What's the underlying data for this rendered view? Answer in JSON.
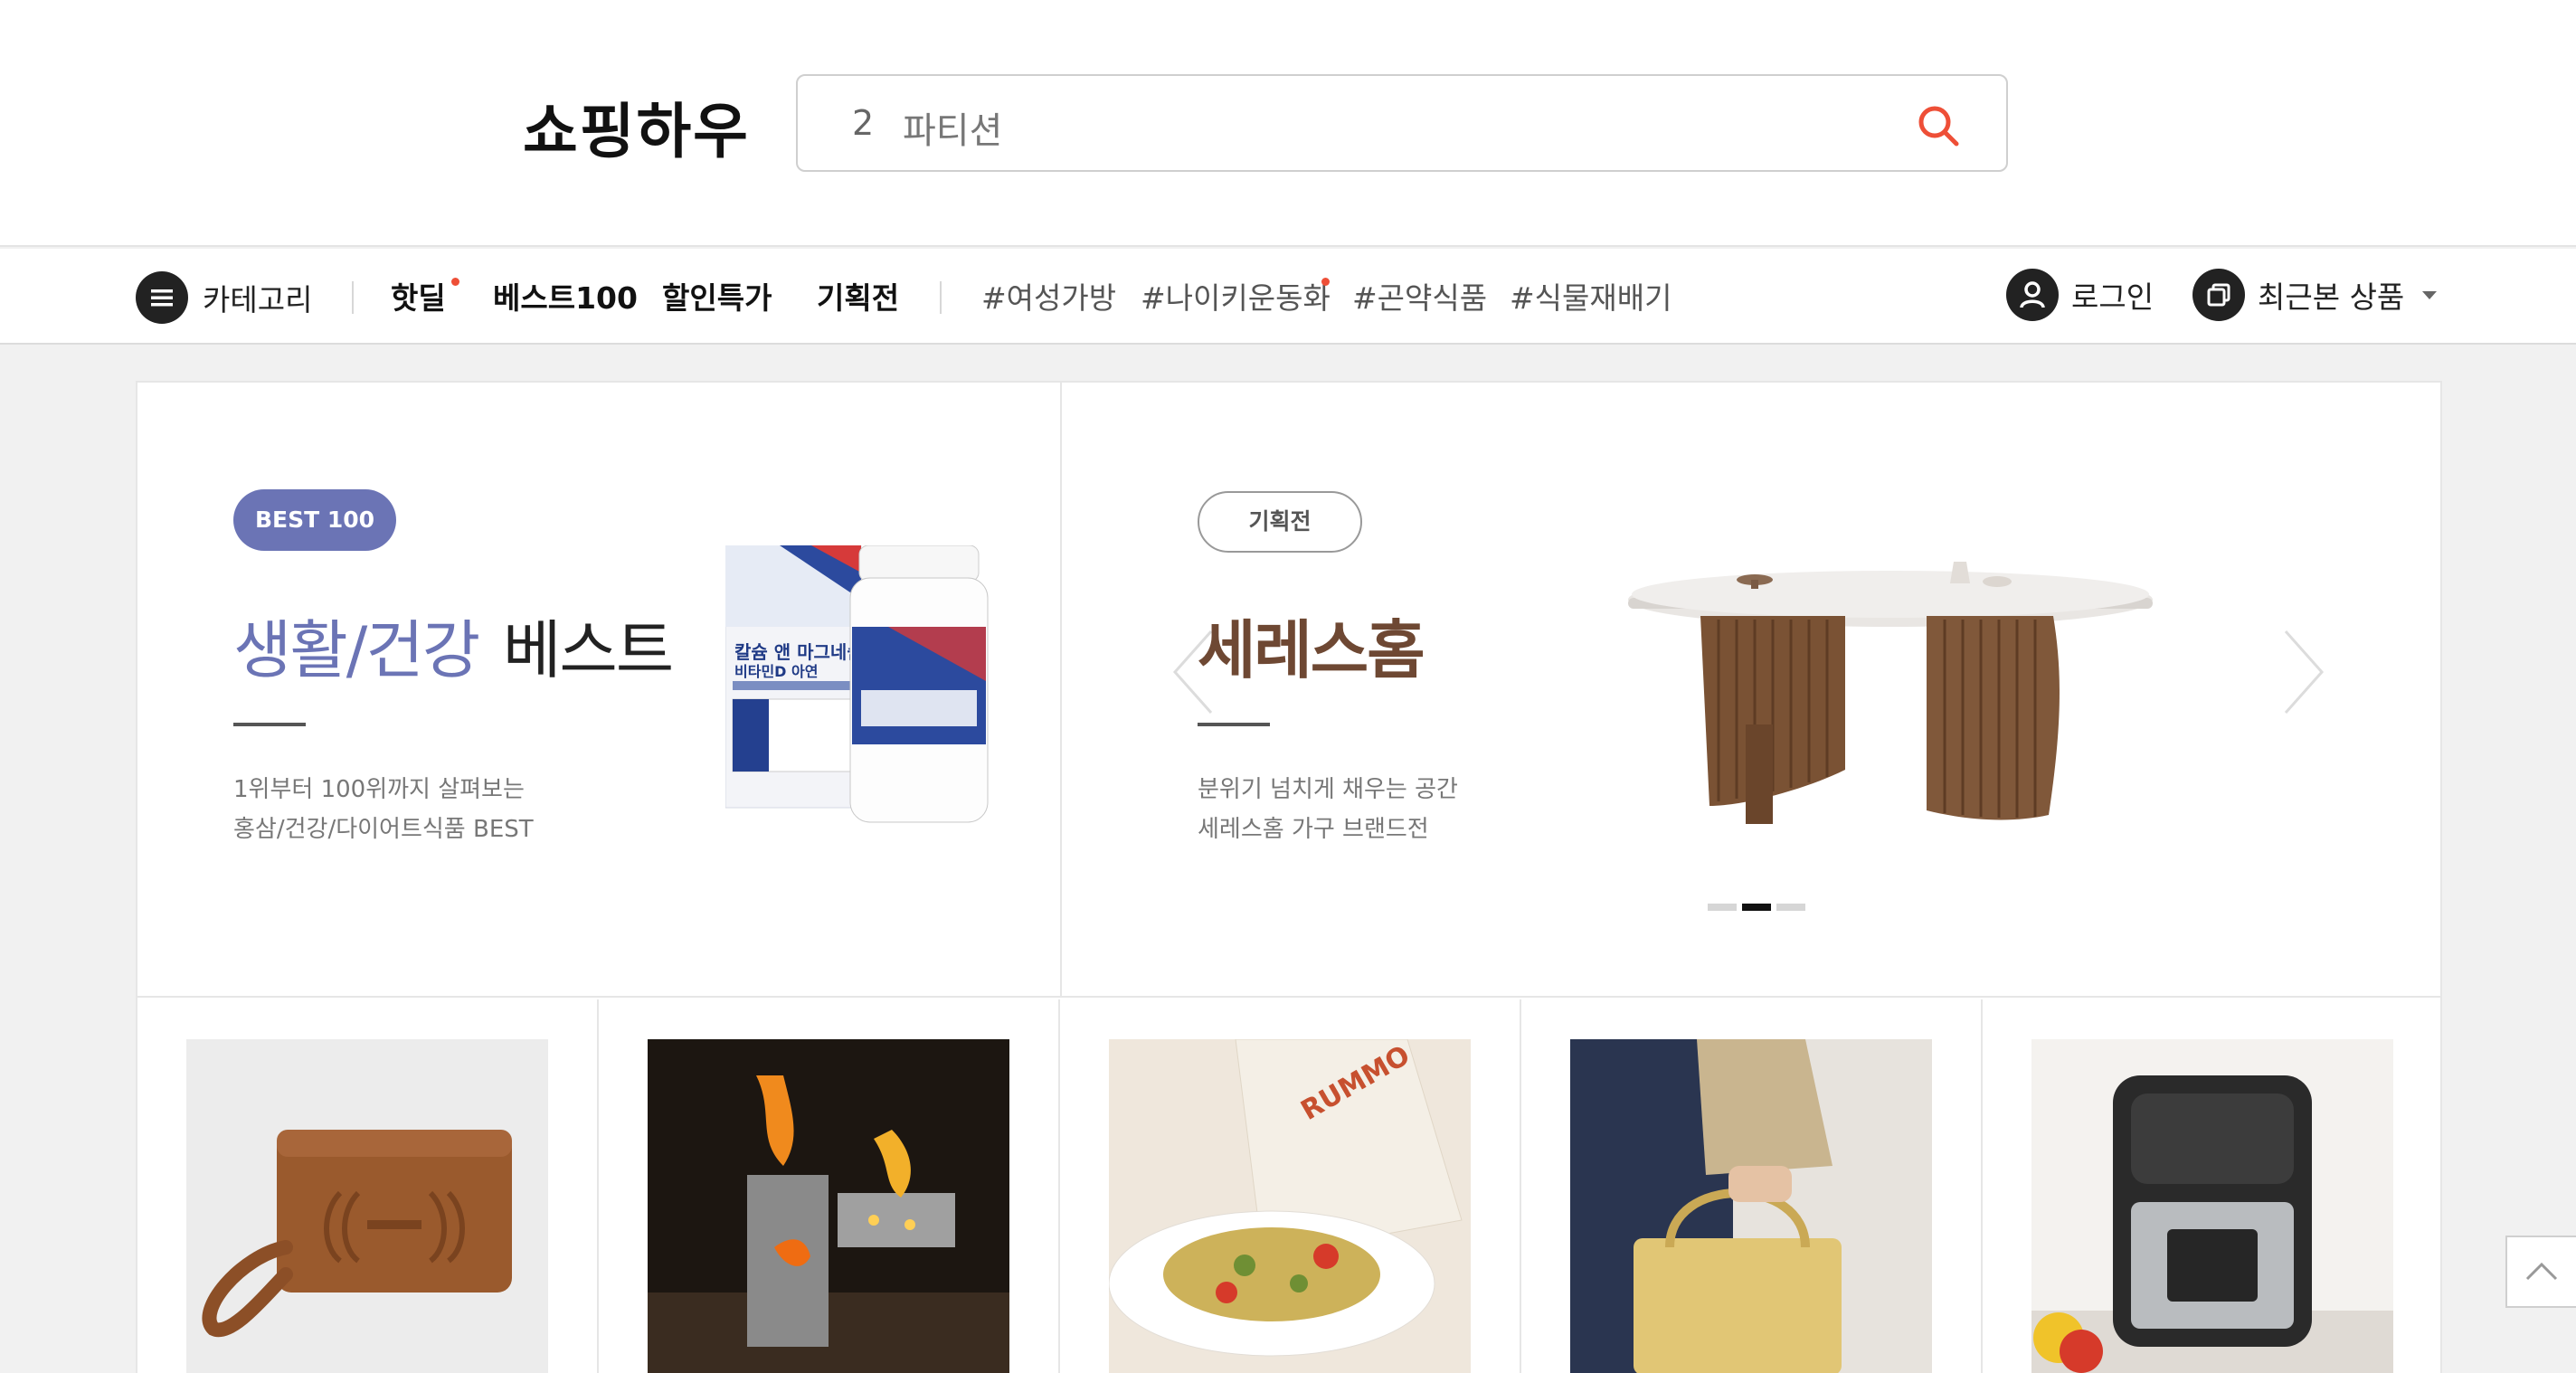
{
  "header": {
    "logo": "쇼핑하우",
    "search": {
      "rank": "2",
      "keyword": "파티션"
    }
  },
  "nav": {
    "category_label": "카테고리",
    "main_items": [
      {
        "label": "핫딜",
        "new_dot": true
      },
      {
        "label": "베스트100",
        "new_dot": false
      },
      {
        "label": "할인특가",
        "new_dot": false
      },
      {
        "label": "기획전",
        "new_dot": false
      }
    ],
    "hashtags": [
      {
        "label": "#여성가방",
        "new_dot": false
      },
      {
        "label": "#나이키운동화",
        "new_dot": true
      },
      {
        "label": "#곤약식품",
        "new_dot": false
      },
      {
        "label": "#식물재배기",
        "new_dot": false
      }
    ],
    "login_label": "로그인",
    "recent_label": "최근본 상품"
  },
  "banner_left": {
    "badge": "BEST 100",
    "title_highlight": "생활/건강",
    "title_rest": "베스트",
    "desc_line1": "1위부터 100위까지 살펴보는",
    "desc_line2": "홍삼/건강/다이어트식품 BEST",
    "product_text_line1": "칼슘 앤 마그네슘",
    "product_text_line2": "비타민D 아연"
  },
  "banner_right": {
    "badge": "기획전",
    "title": "세레스홈",
    "desc_line1": "분위기 넘치게 채우는 공간",
    "desc_line2": "세레스홈 가구 브랜드전",
    "pager": {
      "total": 3,
      "active": 2
    }
  },
  "product_tiles": [
    {
      "icon": "leather-pouch-image"
    },
    {
      "icon": "camping-stove-image"
    },
    {
      "icon": "pasta-dish-image"
    },
    {
      "icon": "tote-bag-image"
    },
    {
      "icon": "air-fryer-image"
    }
  ],
  "colors": {
    "accent_red": "#ee4f37",
    "best_purple": "#6b74b5",
    "brand_brown": "#6e4833"
  }
}
